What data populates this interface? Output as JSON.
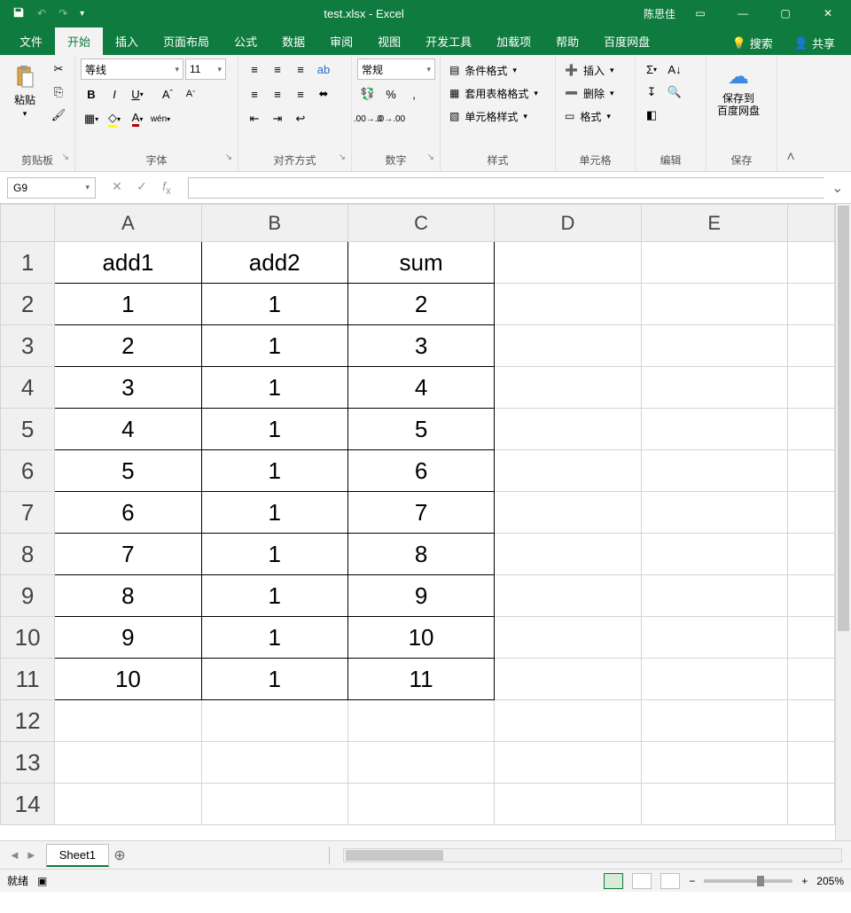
{
  "title_bar": {
    "document": "test.xlsx",
    "app": "Excel",
    "user": "陈思佳"
  },
  "ribbon_tabs": [
    "文件",
    "开始",
    "插入",
    "页面布局",
    "公式",
    "数据",
    "审阅",
    "视图",
    "开发工具",
    "加载项",
    "帮助",
    "百度网盘"
  ],
  "ribbon_right": {
    "search": "搜索",
    "share": "共享"
  },
  "ribbon": {
    "clipboard": {
      "paste": "粘贴",
      "label": "剪贴板"
    },
    "font": {
      "name": "等线",
      "size": "11",
      "label": "字体",
      "phonetic": "wén"
    },
    "alignment": {
      "label": "对齐方式"
    },
    "number": {
      "format": "常规",
      "label": "数字"
    },
    "styles": {
      "conditional": "条件格式",
      "table_fmt": "套用表格格式",
      "cell_styles": "单元格样式",
      "label": "样式"
    },
    "cells": {
      "insert": "插入",
      "delete": "删除",
      "format": "格式",
      "label": "单元格"
    },
    "editing": {
      "label": "编辑"
    },
    "save": {
      "btn": "保存到\n百度网盘",
      "label": "保存"
    }
  },
  "name_box": "G9",
  "columns": [
    "A",
    "B",
    "C",
    "D",
    "E"
  ],
  "rows": [
    "1",
    "2",
    "3",
    "4",
    "5",
    "6",
    "7",
    "8",
    "9",
    "10",
    "11",
    "12",
    "13",
    "14"
  ],
  "cells": {
    "A1": "add1",
    "B1": "add2",
    "C1": "sum",
    "A2": "1",
    "B2": "1",
    "C2": "2",
    "A3": "2",
    "B3": "1",
    "C3": "3",
    "A4": "3",
    "B4": "1",
    "C4": "4",
    "A5": "4",
    "B5": "1",
    "C5": "5",
    "A6": "5",
    "B6": "1",
    "C6": "6",
    "A7": "6",
    "B7": "1",
    "C7": "7",
    "A8": "7",
    "B8": "1",
    "C8": "8",
    "A9": "8",
    "B9": "1",
    "C9": "9",
    "A10": "9",
    "B10": "1",
    "C10": "10",
    "A11": "10",
    "B11": "1",
    "C11": "11"
  },
  "sheet_tab": "Sheet1",
  "status": {
    "ready": "就绪",
    "zoom": "205%"
  },
  "chart_data": {
    "type": "table",
    "columns": [
      "add1",
      "add2",
      "sum"
    ],
    "rows": [
      [
        1,
        1,
        2
      ],
      [
        2,
        1,
        3
      ],
      [
        3,
        1,
        4
      ],
      [
        4,
        1,
        5
      ],
      [
        5,
        1,
        6
      ],
      [
        6,
        1,
        7
      ],
      [
        7,
        1,
        8
      ],
      [
        8,
        1,
        9
      ],
      [
        9,
        1,
        10
      ],
      [
        10,
        1,
        11
      ]
    ]
  }
}
